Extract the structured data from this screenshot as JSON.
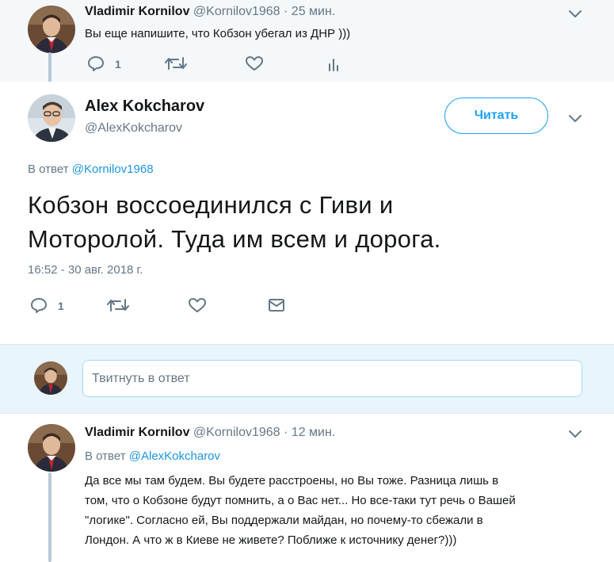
{
  "parent_tweet": {
    "author_name": "Vladimir Kornilov",
    "author_handle": "@Kornilov1968",
    "time": "· 25 мин.",
    "text": "Вы еще напишите, что Кобзон убегал из ДНР )))",
    "reply_count": "1"
  },
  "main_tweet": {
    "author_name": "Alex Kokcharov",
    "author_handle": "@AlexKokcharov",
    "follow_label": "Читать",
    "reply_to_prefix": "В ответ",
    "reply_to_handle": "@Kornilov1968",
    "text_line1": "Кобзон воссоединился с Гиви и",
    "text_line2": "Моторолой. Туда им всем и дорога.",
    "timestamp": "16:52 - 30 авг. 2018 г.",
    "reply_count": "1"
  },
  "composer": {
    "placeholder": "Твитнуть в ответ"
  },
  "reply_tweet": {
    "author_name": "Vladimir Kornilov",
    "author_handle": "@Kornilov1968",
    "time": "· 12 мин.",
    "reply_to_prefix": "В ответ",
    "reply_to_handle": "@AlexKokcharov",
    "lines": [
      "Да все мы там будем. Вы будете расстроены, но Вы тоже. Разница лишь в",
      "том, что о Кобзоне будут помнить, а о Вас нет... Но все-таки тут речь о Вашей",
      "\"логике\". Согласно ей, Вы поддержали майдан, но почему-то сбежали в",
      "Лондон. А что ж в Киеве не живете? Поближе к источнику денег?)))"
    ]
  },
  "colors": {
    "accent": "#1da1f2",
    "link": "#1b95e0",
    "muted": "#657786",
    "thread_line": "#b8c9d6",
    "composer_bg": "#e8f5fd"
  }
}
